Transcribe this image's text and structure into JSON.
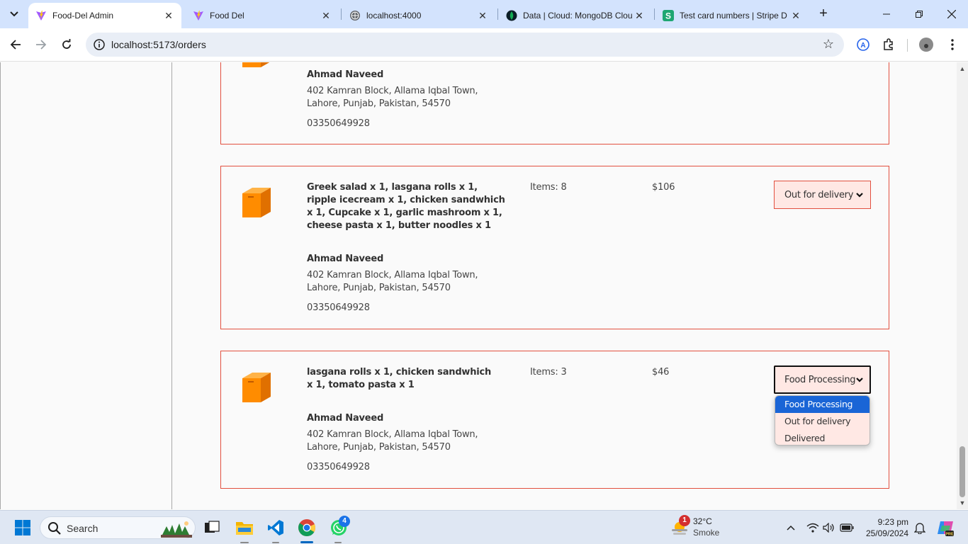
{
  "browser": {
    "tabs": [
      {
        "title": "Food-Del Admin",
        "icon": "vite-icon",
        "active": true
      },
      {
        "title": "Food Del",
        "icon": "vite-icon",
        "active": false
      },
      {
        "title": "localhost:4000",
        "icon": "globe-icon",
        "active": false
      },
      {
        "title": "Data | Cloud: MongoDB Clou",
        "icon": "mongodb-leaf-icon",
        "active": false
      },
      {
        "title": "Test card numbers | Stripe D",
        "icon": "stripe-s-icon",
        "active": false
      }
    ],
    "url": "localhost:5173/orders"
  },
  "orders": [
    {
      "items_text": "",
      "customer_name": "Ahmad Naveed",
      "address_line1": "402 Kamran Block, Allama Iqbal Town,",
      "address_line2": "Lahore, Punjab, Pakistan, 54570",
      "phone": "03350649928"
    },
    {
      "items_text": "Greek salad x 1, lasgana rolls x 1, ripple icecream x 1, chicken sandwhich x 1, Cupcake x 1, garlic mashroom x 1, cheese pasta x 1, butter noodles x 1",
      "items_count": "Items: 8",
      "amount": "$106",
      "status": "Out for delivery",
      "customer_name": "Ahmad Naveed",
      "address_line1": "402 Kamran Block, Allama Iqbal Town,",
      "address_line2": "Lahore, Punjab, Pakistan, 54570",
      "phone": "03350649928"
    },
    {
      "items_text": "lasgana rolls x 1, chicken sandwhich x 1, tomato pasta x 1",
      "items_count": "Items: 3",
      "amount": "$46",
      "status": "Food Processing",
      "customer_name": "Ahmad Naveed",
      "address_line1": "402 Kamran Block, Allama Iqbal Town,",
      "address_line2": "Lahore, Punjab, Pakistan, 54570",
      "phone": "03350649928"
    }
  ],
  "status_dropdown": {
    "options": [
      "Food Processing",
      "Out for delivery",
      "Delivered"
    ],
    "selected": "Food Processing"
  },
  "taskbar": {
    "search_label": "Search",
    "weather_temp": "32°C",
    "weather_cond": "Smoke",
    "weather_badge": "1",
    "whatsapp_badge": "4",
    "time": "9:23 pm",
    "date": "25/09/2024"
  },
  "colors": {
    "accent": "#e2503f",
    "status_bg": "#ffe8e4",
    "selected_option": "#1a65d6",
    "tab_strip": "#d3e3fd"
  }
}
